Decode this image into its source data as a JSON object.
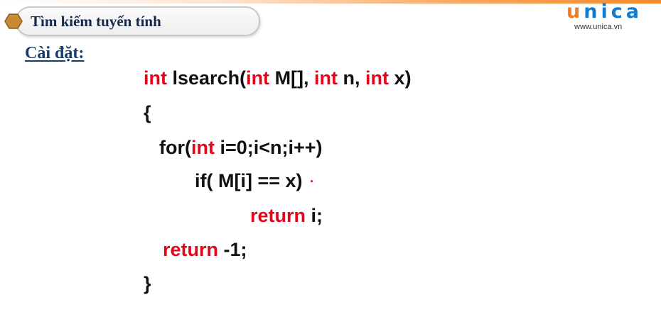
{
  "header": {
    "title": "Tìm kiếm tuyến tính",
    "icon": "hexagon-icon",
    "icon_color": "#c98a34"
  },
  "subheading": "Cài đặt:",
  "logo": {
    "letters": [
      "u",
      "n",
      "i",
      "c",
      "a"
    ],
    "url": "www.unica.vn",
    "primary_color": "#0f7bcf",
    "accent_color": "#f47b20"
  },
  "code": {
    "keyword_color": "#e3061b",
    "lines": [
      [
        {
          "t": "int",
          "kw": true
        },
        {
          "t": " lsearch(",
          "kw": false
        },
        {
          "t": "int",
          "kw": true
        },
        {
          "t": " M[], ",
          "kw": false
        },
        {
          "t": "int",
          "kw": true
        },
        {
          "t": " n, ",
          "kw": false
        },
        {
          "t": "int",
          "kw": true
        },
        {
          "t": " x)",
          "kw": false
        }
      ],
      [
        {
          "t": "{",
          "kw": false
        }
      ],
      [
        {
          "t": "for(",
          "kw": false
        },
        {
          "t": "int",
          "kw": true
        },
        {
          "t": " i=0;i<n;i++)",
          "kw": false
        }
      ],
      [
        {
          "t": "if( M[i] == x)",
          "kw": false
        }
      ],
      [
        {
          "t": "return",
          "kw": true
        },
        {
          "t": " i;",
          "kw": false
        }
      ],
      [
        {
          "t": "return",
          "kw": true
        },
        {
          "t": " -1;",
          "kw": false
        }
      ],
      [
        {
          "t": "}",
          "kw": false
        }
      ]
    ]
  }
}
